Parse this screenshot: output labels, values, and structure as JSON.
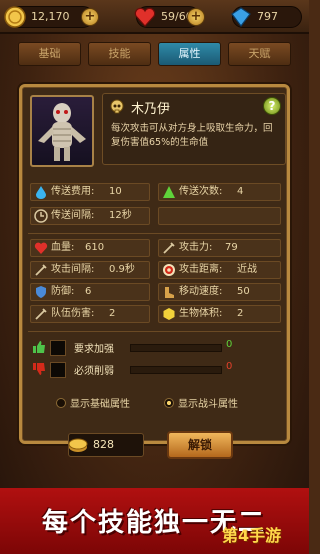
{
  "resources": {
    "gold": "12,170",
    "hearts": "59/60",
    "gems": "797"
  },
  "tabs": [
    "基础",
    "技能",
    "属性",
    "天赋"
  ],
  "monster": {
    "name": "木乃伊",
    "description": "每次攻击可从对方身上吸取生命力，回复伤害值65%的生命值",
    "stats_top": [
      {
        "icon": "drop-icon",
        "label": "传送费用:",
        "value": "10"
      },
      {
        "icon": "triangle-icon",
        "label": "传送次数:",
        "value": "4"
      },
      {
        "icon": "clock-icon",
        "label": "传送间隔:",
        "value": "12秒"
      }
    ],
    "stats": [
      {
        "icon": "heart-icon",
        "label": "血量:",
        "value": "610"
      },
      {
        "icon": "sword-icon",
        "label": "攻击力:",
        "value": "79"
      },
      {
        "icon": "sword-icon",
        "label": "攻击间隔:",
        "value": "0.9秒"
      },
      {
        "icon": "target-icon",
        "label": "攻击距离:",
        "value": "近战"
      },
      {
        "icon": "shield-icon",
        "label": "防御:",
        "value": "6"
      },
      {
        "icon": "boot-icon",
        "label": "移动速度:",
        "value": "50"
      },
      {
        "icon": "sword-icon",
        "label": "队伍伤害:",
        "value": "2"
      },
      {
        "icon": "hex-icon",
        "label": "生物体积:",
        "value": "2"
      }
    ],
    "requirements": [
      {
        "label": "要求加强",
        "value": "0"
      },
      {
        "label": "必须削弱",
        "value": "0"
      }
    ]
  },
  "radio": {
    "basic": "显示基础属性",
    "battle": "显示战斗属性"
  },
  "footer": {
    "gold_cost": "828",
    "unlock": "解锁"
  },
  "banner": {
    "slogan": "每个技能独一无二",
    "watermark": "第4手游"
  },
  "colors": {
    "accent_gold": "#b8893f",
    "tab_active": "#2f8aa8",
    "banner_red": "#b11010"
  }
}
